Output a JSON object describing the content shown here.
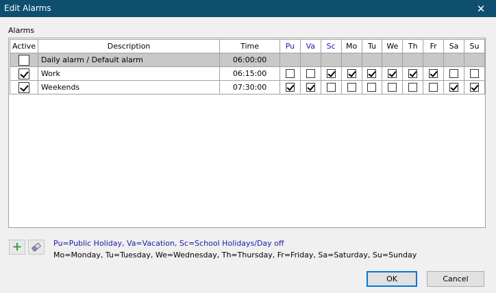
{
  "window": {
    "title": "Edit Alarms",
    "close_glyph": "✕"
  },
  "group_label": "Alarms",
  "columns": {
    "active": "Active",
    "description": "Description",
    "time": "Time",
    "days": [
      "Pu",
      "Va",
      "Sc",
      "Mo",
      "Tu",
      "We",
      "Th",
      "Fr",
      "Sa",
      "Su"
    ],
    "highlighted_days": [
      "Pu",
      "Va",
      "Sc"
    ]
  },
  "rows": [
    {
      "active": false,
      "description": "Daily alarm / Default alarm",
      "time": "06:00:00",
      "is_default": true,
      "days": [
        null,
        null,
        null,
        null,
        null,
        null,
        null,
        null,
        null,
        null
      ]
    },
    {
      "active": true,
      "description": "Work",
      "time": "06:15:00",
      "is_default": false,
      "days": [
        false,
        false,
        true,
        true,
        true,
        true,
        true,
        true,
        false,
        false
      ]
    },
    {
      "active": true,
      "description": "Weekends",
      "time": "07:30:00",
      "is_default": false,
      "days": [
        true,
        true,
        false,
        false,
        false,
        false,
        false,
        false,
        true,
        true
      ]
    }
  ],
  "toolbar": {
    "add_icon": "plus-icon",
    "remove_icon": "eraser-icon"
  },
  "legend": {
    "line1": "Pu=Public Holiday, Va=Vacation, Sc=School Holidays/Day off",
    "line2": "Mo=Monday, Tu=Tuesday, We=Wednesday, Th=Thursday, Fr=Friday, Sa=Saturday, Su=Sunday"
  },
  "buttons": {
    "ok": "OK",
    "cancel": "Cancel"
  },
  "colors": {
    "titlebar": "#0e4e6e",
    "highlight_text": "#1a1aa8",
    "default_row": "#c8c8c8",
    "add_green": "#2ea043"
  }
}
